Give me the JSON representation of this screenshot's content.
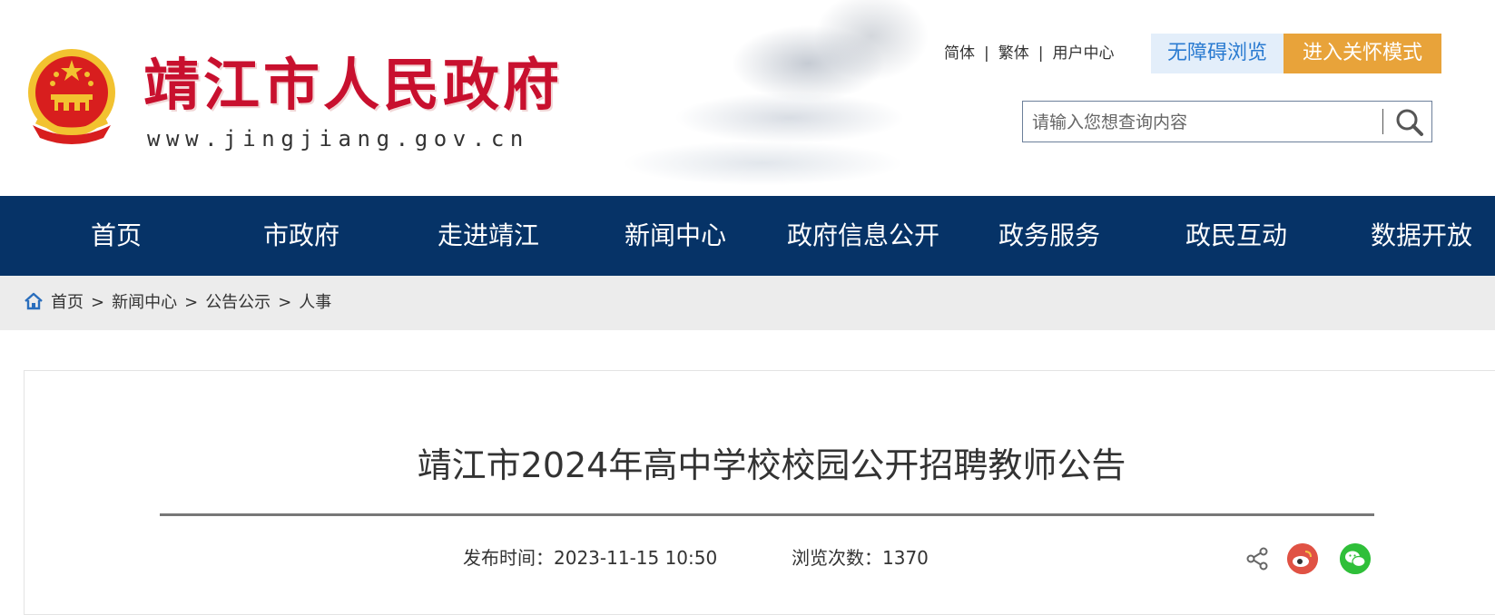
{
  "header": {
    "site_title": "靖江市人民政府",
    "site_url": "www.jingjiang.gov.cn",
    "links": {
      "simplified": "简体",
      "traditional": "繁体",
      "user_center": "用户中心"
    },
    "accessibility_button": "无障碍浏览",
    "care_mode_button": "进入关怀模式",
    "search": {
      "placeholder": "请输入您想查询内容"
    }
  },
  "nav": {
    "items": [
      "首页",
      "市政府",
      "走进靖江",
      "新闻中心",
      "政府信息公开",
      "政务服务",
      "政民互动",
      "数据开放"
    ]
  },
  "breadcrumb": {
    "items": [
      "首页",
      "新闻中心",
      "公告公示",
      "人事"
    ],
    "separator": ">"
  },
  "article": {
    "title": "靖江市2024年高中学校校园公开招聘教师公告",
    "publish_time": "发布时间：2023-11-15 10:50",
    "view_count": "浏览次数：1370"
  },
  "colors": {
    "nav_bg": "#063367",
    "title_red": "#c8102e",
    "accessibility_bg": "#e3eefa",
    "accessibility_text": "#2a7bd1",
    "care_mode_bg": "#e8a33a",
    "weibo": "#e05244",
    "wechat": "#2fbf39"
  },
  "icons": [
    "national-emblem",
    "search-icon",
    "home-icon",
    "share-icon",
    "weibo-icon",
    "wechat-icon"
  ]
}
